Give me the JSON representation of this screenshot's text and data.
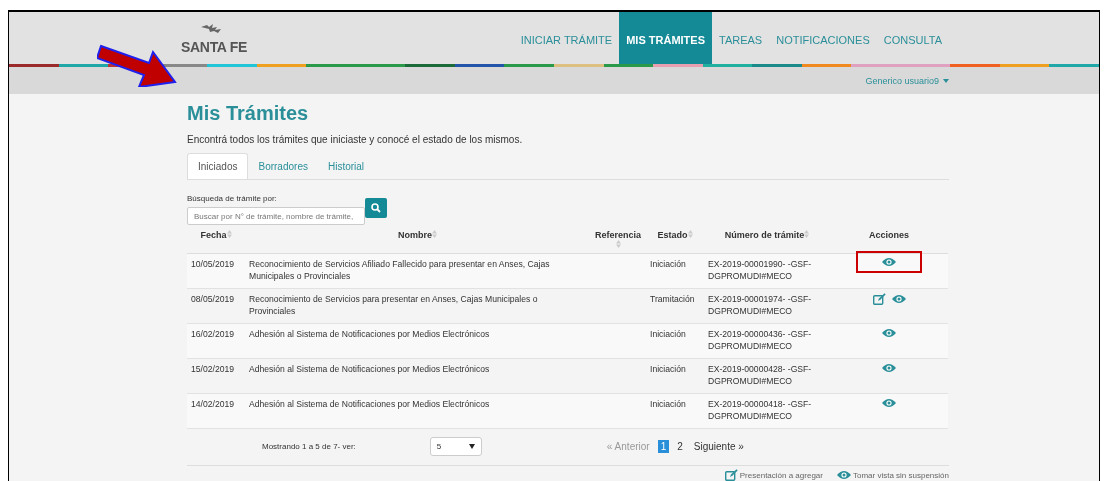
{
  "header": {
    "logo": "SANTA FE",
    "nav": [
      {
        "label": "INICIAR TRÁMITE",
        "selected": false
      },
      {
        "label": "MIS TRÁMITES",
        "selected": true
      },
      {
        "label": "TAREAS",
        "selected": false
      },
      {
        "label": "NOTIFICACIONES",
        "selected": false
      },
      {
        "label": "CONSULTA",
        "selected": false
      }
    ]
  },
  "user_menu": {
    "label": "Generico usuario9"
  },
  "page": {
    "title": "Mis Trámites",
    "subtitle": "Encontrá todos los trámites que iniciaste y conocé el estado de los mismos."
  },
  "tabs": [
    {
      "label": "Iniciados",
      "selected": true
    },
    {
      "label": "Borradores",
      "selected": false
    },
    {
      "label": "Historial",
      "selected": false
    }
  ],
  "search": {
    "label": "Búsqueda de trámite por:",
    "placeholder": "Buscar por N° de trámite, nombre de trámite,"
  },
  "table": {
    "columns": [
      {
        "label": "Fecha",
        "sortable": true
      },
      {
        "label": "Nombre",
        "sortable": true
      },
      {
        "label": "Referencia",
        "sortable": true
      },
      {
        "label": "Estado",
        "sortable": true
      },
      {
        "label": "Número de trámite",
        "sortable": true
      },
      {
        "label": "Acciones",
        "sortable": false
      }
    ],
    "rows": [
      {
        "fecha": "10/05/2019",
        "nombre": "Reconocimiento de Servicios Afiliado Fallecido para presentar en Anses, Cajas Municipales o Provinciales",
        "estado": "Iniciación",
        "numero": "EX-2019-00001990- -GSF-DGPROMUDI#MECO",
        "actions": [
          {
            "kind": "view"
          }
        ],
        "highlighted": true
      },
      {
        "fecha": "08/05/2019",
        "nombre": "Reconocimiento de Servicios para presentar en Anses, Cajas Municipales o Provinciales",
        "estado": "Tramitación",
        "numero": "EX-2019-00001974- -GSF-DGPROMUDI#MECO",
        "actions": [
          {
            "kind": "edit"
          },
          {
            "kind": "view"
          }
        ],
        "highlighted": false
      },
      {
        "fecha": "16/02/2019",
        "nombre": "Adhesión al Sistema de Notificaciones por Medios Electrónicos",
        "estado": "Iniciación",
        "numero": "EX-2019-00000436- -GSF-DGPROMUDI#MECO",
        "actions": [
          {
            "kind": "view"
          }
        ],
        "highlighted": false
      },
      {
        "fecha": "15/02/2019",
        "nombre": "Adhesión al Sistema de Notificaciones por Medios Electrónicos",
        "estado": "Iniciación",
        "numero": "EX-2019-00000428- -GSF-DGPROMUDI#MECO",
        "actions": [
          {
            "kind": "view"
          }
        ],
        "highlighted": false
      },
      {
        "fecha": "14/02/2019",
        "nombre": "Adhesión al Sistema de Notificaciones por Medios Electrónicos",
        "estado": "Iniciación",
        "numero": "EX-2019-00000418- -GSF-DGPROMUDI#MECO",
        "actions": [
          {
            "kind": "view"
          }
        ],
        "highlighted": false
      }
    ]
  },
  "pagination": {
    "summary": "Mostrando 1 a 5 de 7- ver:",
    "page_size": "5",
    "prev": {
      "label": "« Anterior",
      "disabled": true
    },
    "pages": [
      {
        "label": "1",
        "selected": true
      },
      {
        "label": "2",
        "selected": false
      }
    ],
    "next": {
      "label": "Siguiente »",
      "disabled": false
    }
  },
  "legend": [
    {
      "kind": "edit",
      "label": "Presentación a agregar"
    },
    {
      "kind": "view",
      "label": "Tomar vista sin suspensión"
    }
  ]
}
